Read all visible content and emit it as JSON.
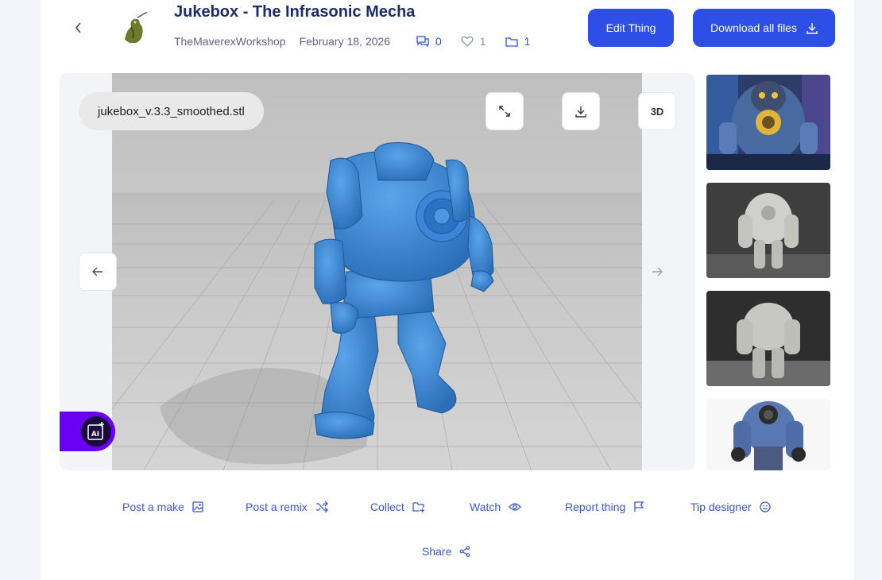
{
  "header": {
    "title": "Jukebox - The Infrasonic Mecha",
    "author": "TheMaverexWorkshop",
    "date": "February 18, 2026",
    "comments_count": "0",
    "likes_count": "1",
    "collections_count": "1",
    "edit_label": "Edit Thing",
    "download_label": "Download all files"
  },
  "viewer": {
    "file_name": "jukebox_v.3.3_smoothed.stl",
    "view_3d_label": "3D",
    "model_color": "#3a86d4"
  },
  "thumbnails": [
    {
      "name": "render-art"
    },
    {
      "name": "printed-front"
    },
    {
      "name": "printed-back"
    },
    {
      "name": "painted-model"
    }
  ],
  "actions": {
    "post_make": "Post a make",
    "post_remix": "Post a remix",
    "collect": "Collect",
    "watch": "Watch",
    "report": "Report thing",
    "tip": "Tip designer",
    "share": "Share"
  },
  "colors": {
    "accent": "#2d4fe7",
    "ai_badge": "#6a00f4"
  }
}
